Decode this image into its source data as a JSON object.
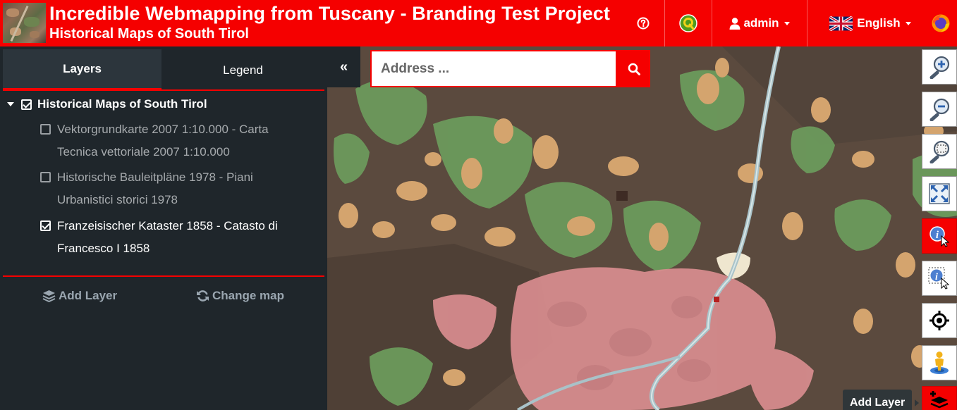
{
  "header": {
    "title": "Incredible Webmapping from Tuscany - Branding Test Project",
    "subtitle": "Historical Maps of South Tirol",
    "help_icon": "question-circle-icon",
    "user_label": "admin",
    "language_label": "English"
  },
  "sidebar": {
    "tabs": [
      {
        "label": "Layers",
        "active": true
      },
      {
        "label": "Legend",
        "active": false
      }
    ],
    "group": {
      "label": "Historical Maps of South Tirol",
      "checked": true
    },
    "layers": [
      {
        "label_line1": "Vektorgrundkarte 2007 1:10.000 - Carta",
        "label_line2": "Tecnica vettoriale 2007 1:10.000",
        "checked": false
      },
      {
        "label_line1": "Historische Bauleitpläne 1978 - Piani",
        "label_line2": "Urbanistici storici 1978",
        "checked": false
      },
      {
        "label_line1": "Franzeisischer Kataster 1858 - Catasto di",
        "label_line2": "Francesco I 1858",
        "checked": true
      }
    ],
    "actions": {
      "add_layer": "Add Layer",
      "change_map": "Change map"
    }
  },
  "map": {
    "search_placeholder": "Address ...",
    "tooltip": "Add Layer",
    "accent_color": "#f50000"
  }
}
